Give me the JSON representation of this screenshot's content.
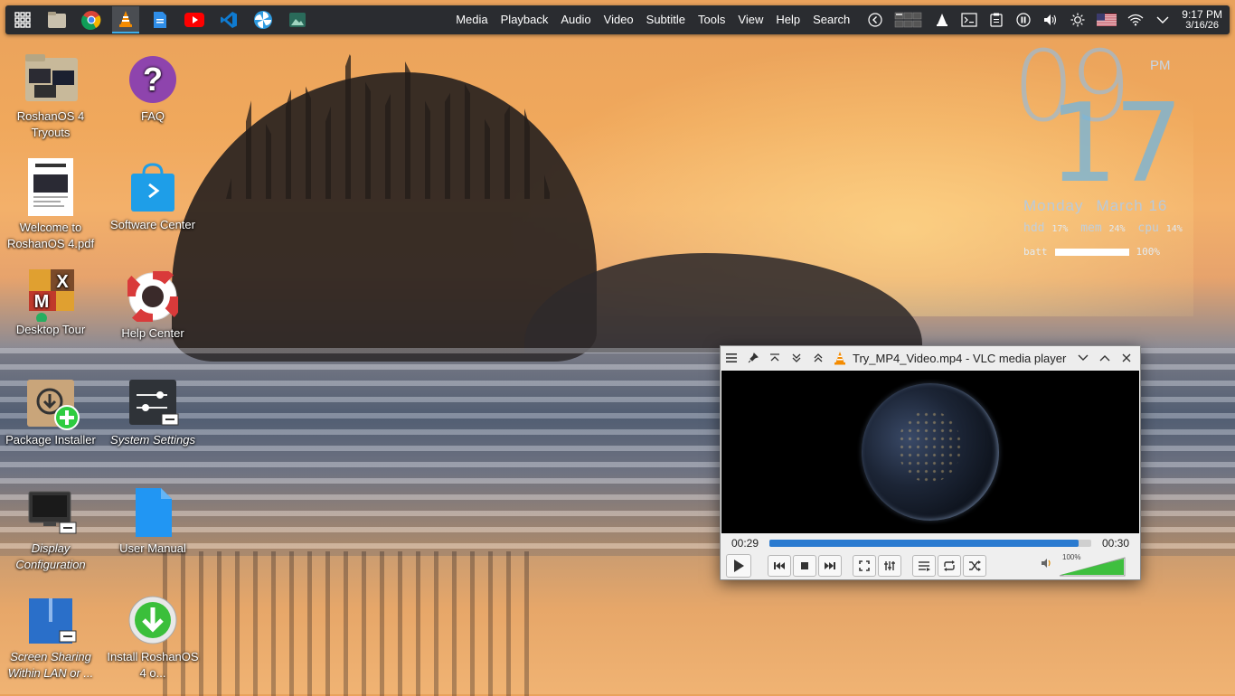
{
  "panel": {
    "apps": [
      {
        "name": "app-launcher-icon"
      },
      {
        "name": "file-manager-icon"
      },
      {
        "name": "chrome-icon"
      },
      {
        "name": "vlc-icon"
      },
      {
        "name": "document-icon"
      },
      {
        "name": "youtube-icon"
      },
      {
        "name": "vscode-icon"
      },
      {
        "name": "pinwheel-icon"
      },
      {
        "name": "image-viewer-icon"
      }
    ],
    "menu": [
      "Media",
      "Playback",
      "Audio",
      "Video",
      "Subtitle",
      "Tools",
      "View",
      "Help",
      "Search"
    ],
    "clock": {
      "time": "9:17 PM",
      "date": "3/16/26"
    }
  },
  "desktop": {
    "icons": [
      {
        "label": "RoshanOS 4 Tryouts"
      },
      {
        "label": "FAQ"
      },
      {
        "label": "Welcome to RoshanOS 4.pdf"
      },
      {
        "label": "Software Center"
      },
      {
        "label": "Desktop Tour"
      },
      {
        "label": "Help Center"
      },
      {
        "label": "Package Installer"
      },
      {
        "label": "System Settings"
      },
      {
        "label": "Display Configuration"
      },
      {
        "label": "User Manual"
      },
      {
        "label": "Screen Sharing Within LAN or ..."
      },
      {
        "label": "Install RoshanOS 4 o..."
      }
    ]
  },
  "conky": {
    "hour": "09",
    "minute": "17",
    "ampm": "PM",
    "day": "Monday",
    "date": "March 16",
    "hdd_label": "hdd",
    "hdd": "17%",
    "mem_label": "mem",
    "mem": "24%",
    "cpu_label": "cpu",
    "cpu": "14%",
    "batt_label": "batt",
    "batt": "100%",
    "batt_level": 1.0
  },
  "vlc": {
    "title": "Try_MP4_Video.mp4 - VLC media player",
    "elapsed": "00:29",
    "total": "00:30",
    "progress": 0.96,
    "volume": "100%",
    "volume_level": 1.0
  },
  "colors": {
    "accent": "#2b7bd0",
    "panel": "#2a2c30",
    "volume": "#3fbf3f"
  }
}
